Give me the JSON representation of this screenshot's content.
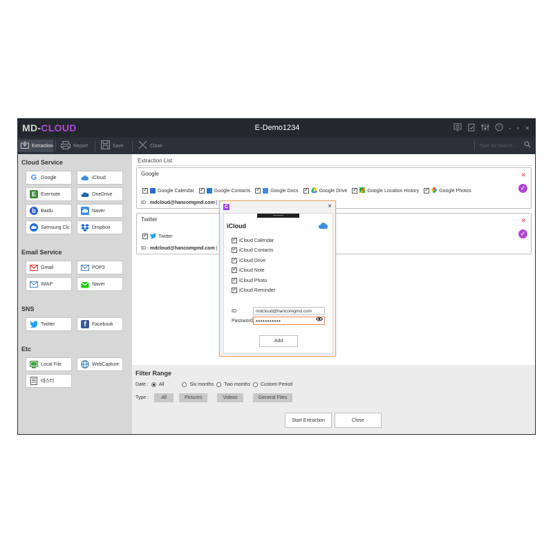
{
  "app": {
    "logo_md": "MD-",
    "logo_cloud": "CLOUD",
    "title": "E-Demo1234",
    "window_controls": {
      "minimize": "-",
      "maximize": "▫",
      "close": "×"
    }
  },
  "toolbar": {
    "extraction": "Extraction",
    "report": "Report",
    "save": "Save",
    "close": "Close",
    "search_placeholder": "Type for search ..."
  },
  "sidebar": {
    "cloud_title": "Cloud Service",
    "cloud": [
      "Google",
      "iCloud",
      "Evernote",
      "OneDrive",
      "Baidu",
      "Naver",
      "Samsung Clc",
      "Dropbox"
    ],
    "email_title": "Email Service",
    "email": [
      "Gmail",
      "POP3",
      "IMAP",
      "Naver"
    ],
    "sns_title": "SNS",
    "sns": [
      "Twitter",
      "Facebook"
    ],
    "etc_title": "Etc",
    "etc": [
      "Local File",
      "WebCapture",
      "테스터"
    ]
  },
  "main": {
    "extraction_list": "Extraction List",
    "google": {
      "title": "Google",
      "items": [
        "Google Calendar",
        "Google Contacts",
        "Google Docs",
        "Google Drive",
        "Google Location History",
        "Google Photos"
      ],
      "id_label": "ID :",
      "id_value": "mdcloud@hancomgmd.com",
      "pw_stub": "| Pa"
    },
    "twitter": {
      "title": "Twitter",
      "items": [
        "Twitter"
      ],
      "id_label": "ID :",
      "id_value": "mdcloud@hancomgmd.com",
      "pw_stub": "| Pa"
    },
    "filter": {
      "title": "Filter Range",
      "date_label": "Date :",
      "date_options": [
        "All",
        "Six months",
        "Two months",
        "Custom Period"
      ],
      "date_selected": "All",
      "type_label": "Type :",
      "type_options": [
        "All",
        "Pictures",
        "Videos",
        "General Files"
      ]
    },
    "start_button": "Start Extraction",
    "close_button": "Close"
  },
  "dialog": {
    "title": "iCloud",
    "items": [
      "iCloud Calendar",
      "iCloud Contacts",
      "iCloud Drive",
      "iCloud Note",
      "iCloud Photo",
      "iCloud Reminder"
    ],
    "id_label": "ID",
    "id_value": "mdcloud@hancomgmd.com",
    "password_label": "Password",
    "password_value": "•••••••••••",
    "add_button": "Add",
    "close": "×",
    "logo": "C"
  },
  "colors": {
    "brand_purple": "#b04ad8",
    "titlebar": "#23272e",
    "toolbar": "#2c3038",
    "sidebar": "#d7d7d7",
    "remove_red": "#e0344b",
    "dialog_border": "#f0a560"
  }
}
